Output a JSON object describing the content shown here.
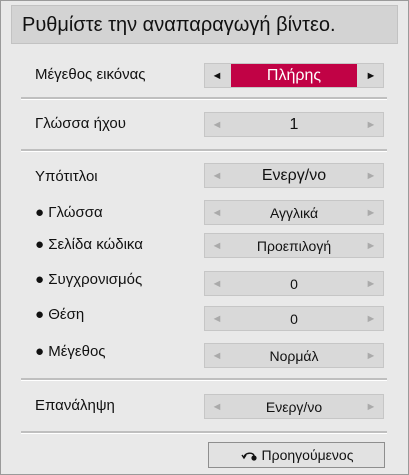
{
  "header": {
    "title": "Ρυθμίστε την αναπαραγωγή βίντεο."
  },
  "rows": {
    "picture_size": {
      "label": "Μέγεθος εικόνας",
      "value": "Πλήρης"
    },
    "audio_language": {
      "label": "Γλώσσα ήχου",
      "value": "1"
    },
    "subtitles": {
      "label": "Υπότιτλοι",
      "value": "Ενεργ/νο"
    },
    "sub_language": {
      "label": "● Γλώσσα",
      "value": "Αγγλικά"
    },
    "code_page": {
      "label": "● Σελίδα κώδικα",
      "value": "Προεπιλογή"
    },
    "sync": {
      "label": "● Συγχρονισμός",
      "value": "0"
    },
    "position": {
      "label": "● Θέση",
      "value": "0"
    },
    "size": {
      "label": "● Μέγεθος",
      "value": "Νορμάλ"
    },
    "repeat": {
      "label": "Επανάληψη",
      "value": "Ενεργ/νο"
    }
  },
  "arrows": {
    "left": "◄",
    "right": "►"
  },
  "footer": {
    "back_label": "Προηγούμενος"
  },
  "colors": {
    "highlight": "#c10245",
    "panel": "#e9e9e9",
    "selector": "#d9d9d9"
  },
  "icons": {
    "back": "return-arrow-icon"
  }
}
